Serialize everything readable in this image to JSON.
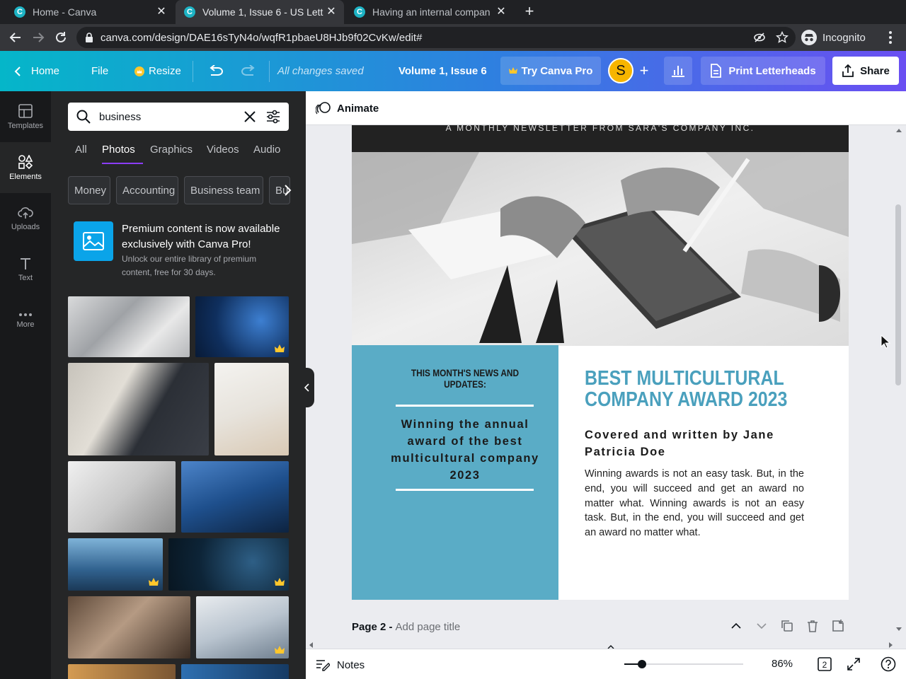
{
  "browser": {
    "tabs": [
      {
        "title": "Home - Canva",
        "active": false
      },
      {
        "title": "Volume 1, Issue 6 - US Lett",
        "active": true
      },
      {
        "title": "Having an internal compan",
        "active": false
      }
    ],
    "url": "canva.com/design/DAE16sTyN4o/wqfR1pbaeU8HJb9f02CvKw/edit#",
    "profile": "Incognito"
  },
  "header": {
    "home": "Home",
    "file": "File",
    "resize": "Resize",
    "saved_status": "All changes saved",
    "doc_title": "Volume 1, Issue 6",
    "try_pro": "Try Canva Pro",
    "avatar_initial": "S",
    "print": "Print Letterheads",
    "share": "Share"
  },
  "rail": {
    "items": [
      {
        "label": "Templates",
        "active": false
      },
      {
        "label": "Elements",
        "active": true
      },
      {
        "label": "Uploads",
        "active": false
      },
      {
        "label": "Text",
        "active": false
      },
      {
        "label": "More",
        "active": false
      }
    ]
  },
  "panel": {
    "search_value": "business",
    "tabs": [
      "All",
      "Photos",
      "Graphics",
      "Videos",
      "Audio"
    ],
    "active_tab": "Photos",
    "chips": [
      "Money",
      "Accounting",
      "Business team",
      "Bu"
    ],
    "promo_title": "Premium content is now available exclusively with Canva Pro!",
    "promo_desc": "Unlock our entire library of premium content, free for 30 days."
  },
  "toolbar": {
    "animate": "Animate"
  },
  "design": {
    "tagline": "A MONTHLY NEWSLETTER FROM SARA'S COMPANY INC.",
    "news_label": "THIS MONTH'S NEWS AND UPDATES:",
    "winning": "Winning the annual award of the best multicultural company 2023",
    "award_title_line1": "BEST MULTICULTURAL",
    "award_title_line2": "COMPANY AWARD 2023",
    "byline": "Covered and written by Jane Patricia Doe",
    "body": "Winning awards is not an easy task. But, in the end, you will succeed and get an award no matter what. Winning awards is not an easy task. But, in the end, you will succeed and get an award no matter what."
  },
  "page_footer": {
    "page_label": "Page 2 -",
    "page_title_placeholder": "Add page title"
  },
  "status": {
    "notes": "Notes",
    "zoom": "86%",
    "page_count": "2"
  },
  "colors": {
    "header_gradient_start": "#05b6c9",
    "header_gradient_end": "#6a4ff2",
    "design_blue": "#5aacc6",
    "title_blue": "#4aa0bd",
    "avatar_yellow": "#f7b500"
  }
}
